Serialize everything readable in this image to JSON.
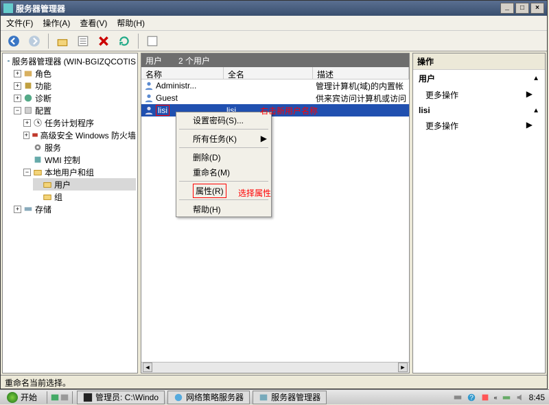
{
  "window": {
    "title": "服务器管理器",
    "minimize": "_",
    "restore": "□",
    "close": "×"
  },
  "menubar": {
    "file": "文件(F)",
    "action": "操作(A)",
    "view": "查看(V)",
    "help": "帮助(H)"
  },
  "tree": {
    "root": "服务器管理器 (WIN-BGIZQCOTIS",
    "roles": "角色",
    "features": "功能",
    "diagnostics": "诊断",
    "config": "配置",
    "taskSched": "任务计划程序",
    "firewall": "高级安全 Windows 防火墙",
    "services": "服务",
    "wmi": "WMI 控制",
    "localUsersGroups": "本地用户和组",
    "users": "用户",
    "groups": "组",
    "storage": "存储"
  },
  "mid": {
    "header_title": "用户",
    "header_count": "2 个用户",
    "col_name": "名称",
    "col_fullname": "全名",
    "col_desc": "描述",
    "rows": [
      {
        "name": "Administr...",
        "fullname": "",
        "desc": "管理计算机(域)的内置帐"
      },
      {
        "name": "Guest",
        "fullname": "",
        "desc": "供来宾访问计算机或访问"
      },
      {
        "name": "lisi",
        "fullname": "lisi",
        "desc": ""
      }
    ]
  },
  "ctx": {
    "setPwd": "设置密码(S)...",
    "allTasks": "所有任务(K)",
    "delete": "删除(D)",
    "rename": "重命名(M)",
    "props": "属性(R)",
    "help": "帮助(H)"
  },
  "actions": {
    "title": "操作",
    "sec1": "用户",
    "more1": "更多操作",
    "sec2": "lisi",
    "more2": "更多操作"
  },
  "status": "重命名当前选择。",
  "annotations": {
    "a1": "右击新用户名称",
    "a2": "选择属性"
  },
  "taskbar": {
    "start": "开始",
    "t1": "管理员: C:\\Windo",
    "t2": "网络策略服务器",
    "t3": "服务器管理器",
    "time": "8:45"
  }
}
